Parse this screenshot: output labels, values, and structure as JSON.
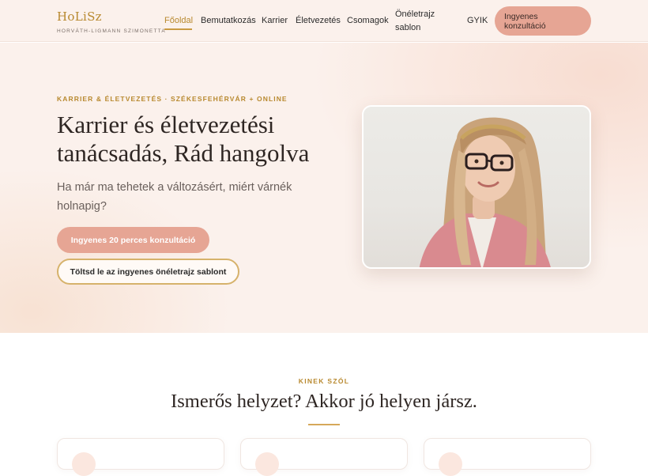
{
  "brand": {
    "name": "HoLiSz",
    "subtitle": "HORVÁTH-LIGMANN SZIMONETTA",
    "accent": "#b8892f",
    "primary": "#e6a594"
  },
  "nav": {
    "items": [
      {
        "label": "Főoldal",
        "active": true
      },
      {
        "label": "Bemutatkozás"
      },
      {
        "label": "Karrier"
      },
      {
        "label": "Életvezetés"
      },
      {
        "label": "Csomagok"
      },
      {
        "label": "Önéletrajz sablon"
      },
      {
        "label": "GYIK"
      }
    ],
    "cta": "Ingyenes konzultáció"
  },
  "hero": {
    "eyebrow": "KARRIER & ÉLETVEZETÉS · SZÉKESFEHÉRVÁR + ONLINE",
    "title": "Karrier és életvezetési tanácsadás, Rád hangolva",
    "subtitle": "Ha már ma tehetek a változásért, miért várnék holnapig?",
    "primary_button": "Ingyenes 20 perces konzultáció",
    "secondary_button": "Töltsd le az ingyenes önéletrajz sablont"
  },
  "section": {
    "eyebrow": "KINEK SZÓL",
    "title": "Ismerős helyzet? Akkor jó helyen jársz."
  }
}
